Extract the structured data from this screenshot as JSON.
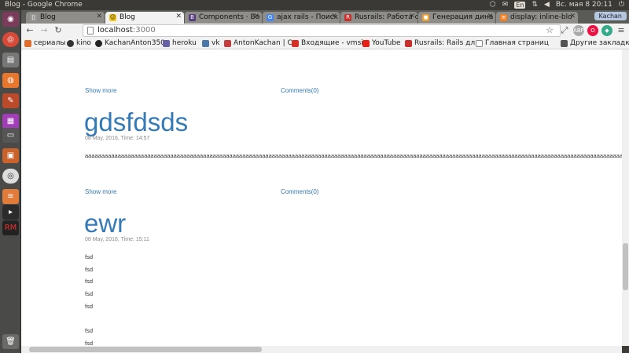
{
  "window": {
    "title": "Blog - Google Chrome"
  },
  "system_tray": {
    "keyboard_layout": "En",
    "clock": "Вс. мая  8 20:11",
    "user": "Kachan"
  },
  "tabs": [
    {
      "label": "Blog",
      "icon": "page-icon",
      "active": false
    },
    {
      "label": "Blog",
      "icon": "smiley-icon",
      "active": true
    },
    {
      "label": "Components · Bo",
      "icon": "bootstrap-icon",
      "active": false
    },
    {
      "label": "ajax rails - Поиск",
      "icon": "google-icon",
      "active": false
    },
    {
      "label": "Rusrails: Работа с",
      "icon": "rusrails-icon",
      "active": false
    },
    {
      "label": "Генерация дина",
      "icon": "orange-icon",
      "active": false
    },
    {
      "label": "display: inline-blo",
      "icon": "stackoverflow-icon",
      "active": false
    }
  ],
  "address_bar": {
    "host": "localhost",
    "port": ":3000"
  },
  "bookmarks": [
    {
      "label": "сериалы",
      "icon": "bookmark-icon",
      "color": "#e06d2c"
    },
    {
      "label": "kino",
      "icon": "incognito-icon",
      "color": "#333333"
    },
    {
      "label": "KachanAnton350",
      "icon": "github-icon",
      "color": "#222222"
    },
    {
      "label": "heroku",
      "icon": "heroku-icon",
      "color": "#6762a6"
    },
    {
      "label": "vk",
      "icon": "vk-icon",
      "color": "#4a76a8"
    },
    {
      "label": "AntonKachan | Co",
      "icon": "codecademy-icon",
      "color": "#c43c3c"
    },
    {
      "label": "Входящие - vmsi",
      "icon": "gmail-icon",
      "color": "#d93025"
    },
    {
      "label": "YouTube",
      "icon": "youtube-icon",
      "color": "#e62117"
    },
    {
      "label": "Rusrails: Rails для",
      "icon": "rusrails-icon",
      "color": "#c9302c"
    },
    {
      "label": "Главная страниц",
      "icon": "page-icon",
      "color": "#888888"
    },
    {
      "label": "Другие закладки",
      "icon": "folder-icon",
      "color": "#555555"
    }
  ],
  "page": {
    "top_links": {
      "show_more": "Show more",
      "comments": "Comments(0)"
    },
    "posts": [
      {
        "title": "gdsfdsds",
        "date": "08 May, 2016, Time: 14:57",
        "body_lines": [
          "aaaaaaaaaaaaaaaaaaaaaaaaaaaaaaaaaaaaaaaaaaaaaaaaaaaaaaaaaaaaaaaaaaaaaaaaaaaaaaaaaaaaaaaaaaaaaaaaaaaaaaaaaaaaaaaaaaaaaaaaaaaaaaaaaaaaaaaaaaaaaaaaaaaaaaaaaaaaaaaaaaaaaa"
        ],
        "show_more": "Show more",
        "comments": "Comments(0)"
      },
      {
        "title": "ewr",
        "date": "08 May, 2016, Time: 15:11",
        "body_lines": [
          "fsd",
          "fsd",
          "fsd",
          "fsd",
          "fsd",
          "fsd",
          "fsd"
        ]
      }
    ]
  }
}
